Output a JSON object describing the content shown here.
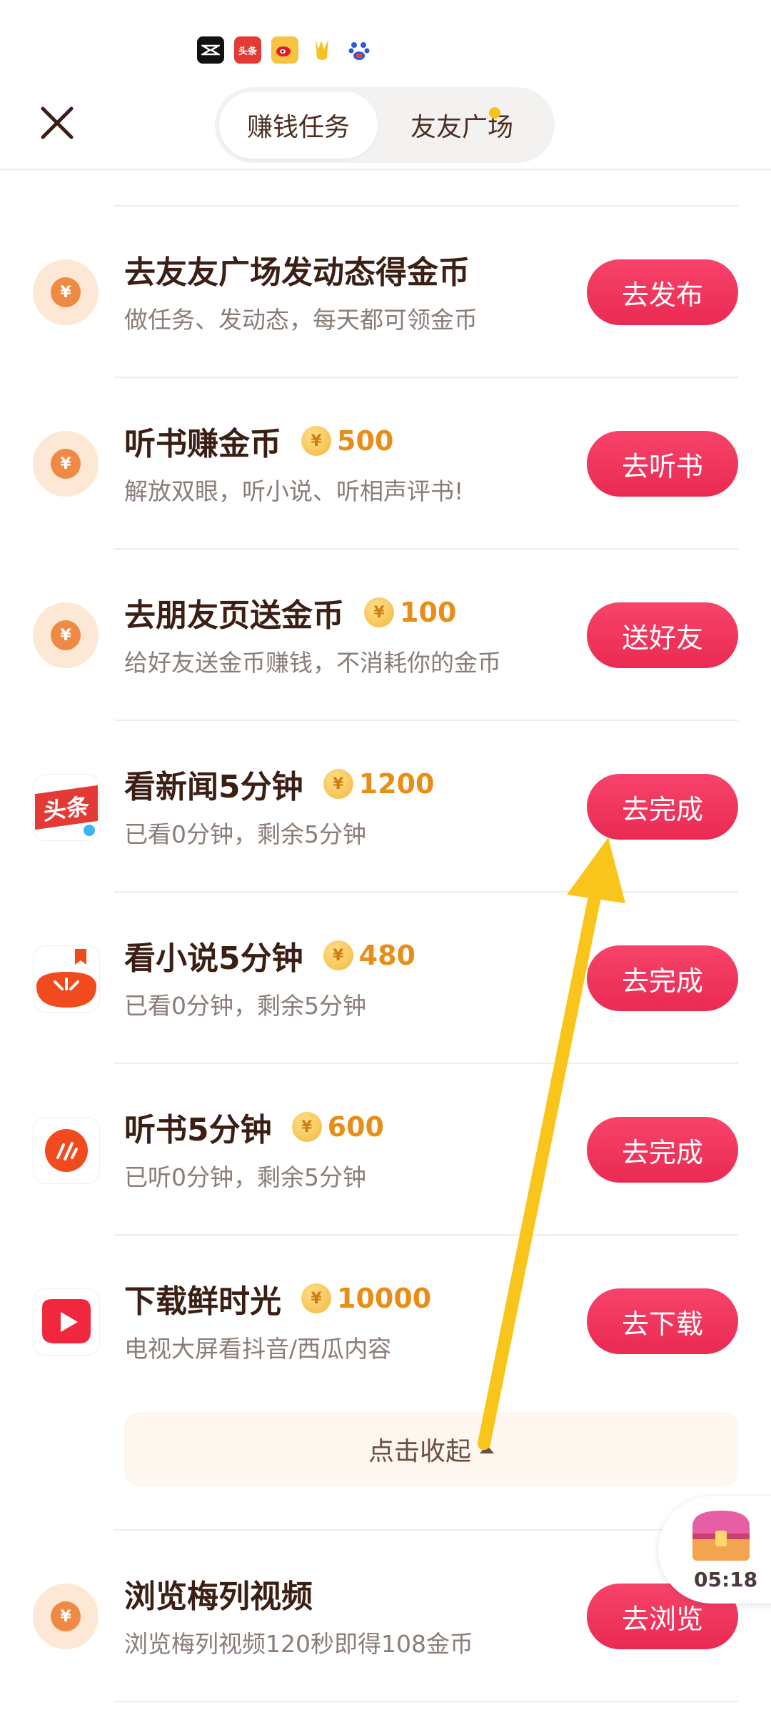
{
  "status_bar": {
    "icons": [
      "capcut-icon",
      "toutiao-icon",
      "weibo-icon",
      "mascot-icon",
      "baidu-icon"
    ],
    "toutiao_text": "头条"
  },
  "header": {
    "tabs": [
      {
        "label": "赚钱任务",
        "active": true
      },
      {
        "label": "友友广场",
        "active": false,
        "has_dot": true
      }
    ]
  },
  "colors": {
    "accent": "#ef2d55",
    "reward": "#e88e16",
    "title": "#3b1e14",
    "subtitle": "#8a7d78",
    "arrow": "#f9c51b"
  },
  "tasks": [
    {
      "icon": "coin-icon",
      "title": "去友友广场发动态得金币",
      "reward": "",
      "subtitle": "做任务、发动态，每天都可领金币",
      "button": "去发布"
    },
    {
      "icon": "coin-icon",
      "title": "听书赚金币",
      "reward": "500",
      "subtitle": "解放双眼，听小说、听相声评书!",
      "button": "去听书"
    },
    {
      "icon": "coin-icon",
      "title": "去朋友页送金币",
      "reward": "100",
      "subtitle": "给好友送金币赚钱，不消耗你的金币",
      "button": "送好友"
    },
    {
      "icon": "toutiao-app-icon",
      "icon_text": "头条",
      "title": "看新闻5分钟",
      "reward": "1200",
      "subtitle": "已看0分钟，剩余5分钟",
      "button": "去完成"
    },
    {
      "icon": "tomato-novel-icon",
      "title": "看小说5分钟",
      "reward": "480",
      "subtitle": "已看0分钟，剩余5分钟",
      "button": "去完成"
    },
    {
      "icon": "tomato-listen-icon",
      "title": "听书5分钟",
      "reward": "600",
      "subtitle": "已听0分钟，剩余5分钟",
      "button": "去完成"
    },
    {
      "icon": "xianshiguang-icon",
      "title": "下载鲜时光",
      "reward": "10000",
      "subtitle": "电视大屏看抖音/西瓜内容",
      "button": "去下载"
    }
  ],
  "collapse_label": "点击收起",
  "last_task": {
    "icon": "coin-icon",
    "title": "浏览梅列视频",
    "subtitle": "浏览梅列视频120秒即得108金币",
    "button": "去浏览"
  },
  "float_widget": {
    "icon": "treasure-chest-icon",
    "timer": "05:18"
  },
  "coin_symbol": "¥"
}
